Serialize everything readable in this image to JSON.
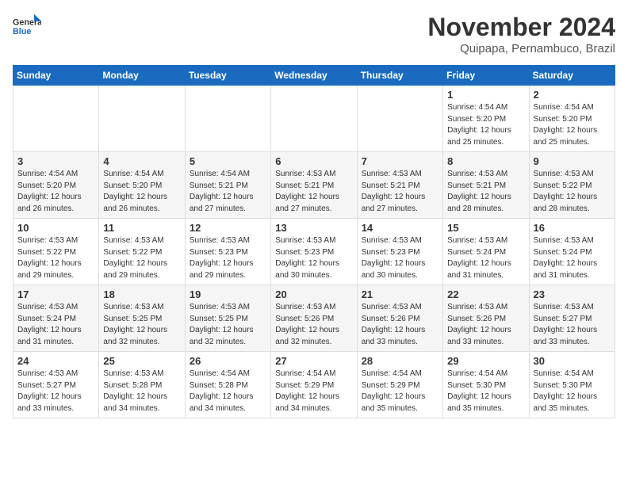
{
  "logo": {
    "line1": "General",
    "line2": "Blue"
  },
  "title": "November 2024",
  "location": "Quipapa, Pernambuco, Brazil",
  "weekdays": [
    "Sunday",
    "Monday",
    "Tuesday",
    "Wednesday",
    "Thursday",
    "Friday",
    "Saturday"
  ],
  "weeks": [
    [
      {
        "day": "",
        "info": ""
      },
      {
        "day": "",
        "info": ""
      },
      {
        "day": "",
        "info": ""
      },
      {
        "day": "",
        "info": ""
      },
      {
        "day": "",
        "info": ""
      },
      {
        "day": "1",
        "info": "Sunrise: 4:54 AM\nSunset: 5:20 PM\nDaylight: 12 hours and 25 minutes."
      },
      {
        "day": "2",
        "info": "Sunrise: 4:54 AM\nSunset: 5:20 PM\nDaylight: 12 hours and 25 minutes."
      }
    ],
    [
      {
        "day": "3",
        "info": "Sunrise: 4:54 AM\nSunset: 5:20 PM\nDaylight: 12 hours and 26 minutes."
      },
      {
        "day": "4",
        "info": "Sunrise: 4:54 AM\nSunset: 5:20 PM\nDaylight: 12 hours and 26 minutes."
      },
      {
        "day": "5",
        "info": "Sunrise: 4:54 AM\nSunset: 5:21 PM\nDaylight: 12 hours and 27 minutes."
      },
      {
        "day": "6",
        "info": "Sunrise: 4:53 AM\nSunset: 5:21 PM\nDaylight: 12 hours and 27 minutes."
      },
      {
        "day": "7",
        "info": "Sunrise: 4:53 AM\nSunset: 5:21 PM\nDaylight: 12 hours and 27 minutes."
      },
      {
        "day": "8",
        "info": "Sunrise: 4:53 AM\nSunset: 5:21 PM\nDaylight: 12 hours and 28 minutes."
      },
      {
        "day": "9",
        "info": "Sunrise: 4:53 AM\nSunset: 5:22 PM\nDaylight: 12 hours and 28 minutes."
      }
    ],
    [
      {
        "day": "10",
        "info": "Sunrise: 4:53 AM\nSunset: 5:22 PM\nDaylight: 12 hours and 29 minutes."
      },
      {
        "day": "11",
        "info": "Sunrise: 4:53 AM\nSunset: 5:22 PM\nDaylight: 12 hours and 29 minutes."
      },
      {
        "day": "12",
        "info": "Sunrise: 4:53 AM\nSunset: 5:23 PM\nDaylight: 12 hours and 29 minutes."
      },
      {
        "day": "13",
        "info": "Sunrise: 4:53 AM\nSunset: 5:23 PM\nDaylight: 12 hours and 30 minutes."
      },
      {
        "day": "14",
        "info": "Sunrise: 4:53 AM\nSunset: 5:23 PM\nDaylight: 12 hours and 30 minutes."
      },
      {
        "day": "15",
        "info": "Sunrise: 4:53 AM\nSunset: 5:24 PM\nDaylight: 12 hours and 31 minutes."
      },
      {
        "day": "16",
        "info": "Sunrise: 4:53 AM\nSunset: 5:24 PM\nDaylight: 12 hours and 31 minutes."
      }
    ],
    [
      {
        "day": "17",
        "info": "Sunrise: 4:53 AM\nSunset: 5:24 PM\nDaylight: 12 hours and 31 minutes."
      },
      {
        "day": "18",
        "info": "Sunrise: 4:53 AM\nSunset: 5:25 PM\nDaylight: 12 hours and 32 minutes."
      },
      {
        "day": "19",
        "info": "Sunrise: 4:53 AM\nSunset: 5:25 PM\nDaylight: 12 hours and 32 minutes."
      },
      {
        "day": "20",
        "info": "Sunrise: 4:53 AM\nSunset: 5:26 PM\nDaylight: 12 hours and 32 minutes."
      },
      {
        "day": "21",
        "info": "Sunrise: 4:53 AM\nSunset: 5:26 PM\nDaylight: 12 hours and 33 minutes."
      },
      {
        "day": "22",
        "info": "Sunrise: 4:53 AM\nSunset: 5:26 PM\nDaylight: 12 hours and 33 minutes."
      },
      {
        "day": "23",
        "info": "Sunrise: 4:53 AM\nSunset: 5:27 PM\nDaylight: 12 hours and 33 minutes."
      }
    ],
    [
      {
        "day": "24",
        "info": "Sunrise: 4:53 AM\nSunset: 5:27 PM\nDaylight: 12 hours and 33 minutes."
      },
      {
        "day": "25",
        "info": "Sunrise: 4:53 AM\nSunset: 5:28 PM\nDaylight: 12 hours and 34 minutes."
      },
      {
        "day": "26",
        "info": "Sunrise: 4:54 AM\nSunset: 5:28 PM\nDaylight: 12 hours and 34 minutes."
      },
      {
        "day": "27",
        "info": "Sunrise: 4:54 AM\nSunset: 5:29 PM\nDaylight: 12 hours and 34 minutes."
      },
      {
        "day": "28",
        "info": "Sunrise: 4:54 AM\nSunset: 5:29 PM\nDaylight: 12 hours and 35 minutes."
      },
      {
        "day": "29",
        "info": "Sunrise: 4:54 AM\nSunset: 5:30 PM\nDaylight: 12 hours and 35 minutes."
      },
      {
        "day": "30",
        "info": "Sunrise: 4:54 AM\nSunset: 5:30 PM\nDaylight: 12 hours and 35 minutes."
      }
    ]
  ]
}
